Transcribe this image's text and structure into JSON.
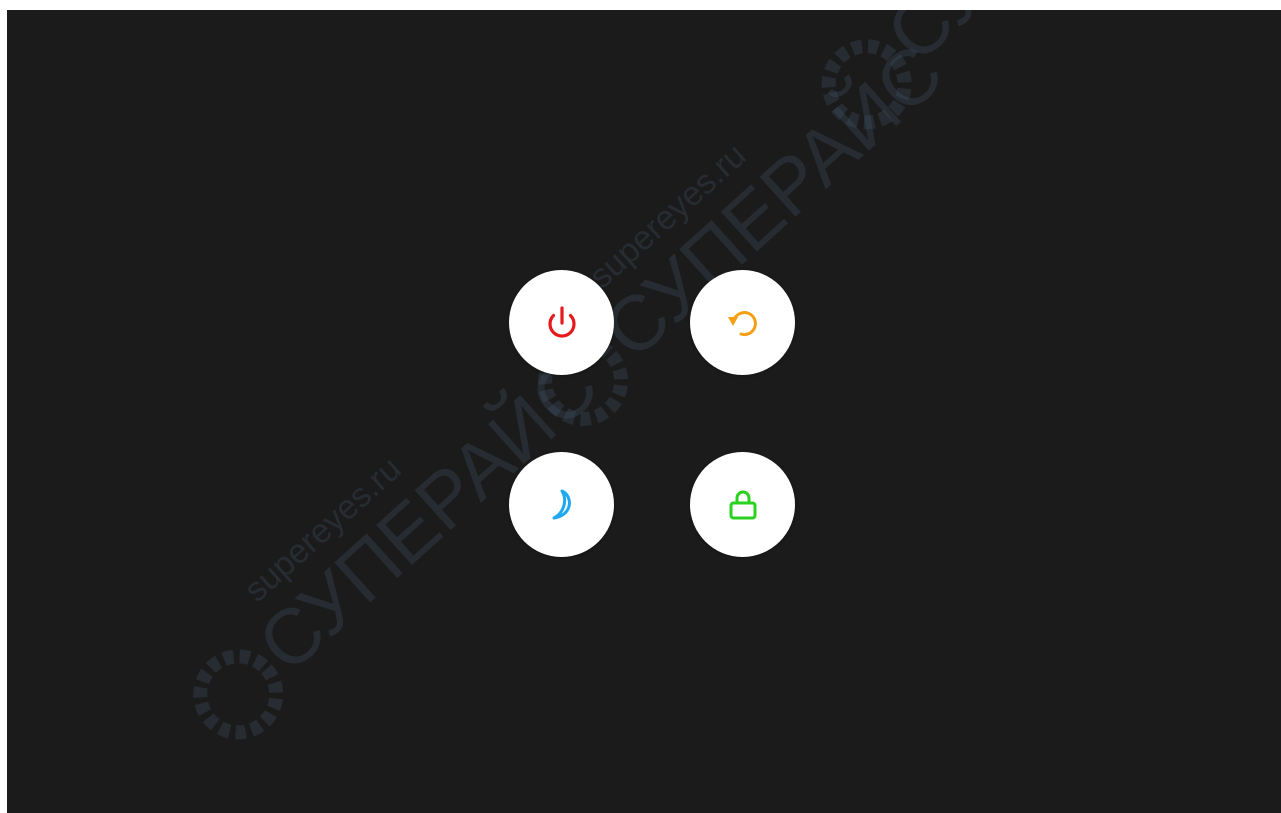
{
  "power_menu": {
    "actions": [
      {
        "id": "power",
        "icon": "power-icon",
        "color": "#e8191c"
      },
      {
        "id": "restart",
        "icon": "restart-icon",
        "color": "#f5a012"
      },
      {
        "id": "sleep",
        "icon": "moon-icon",
        "color": "#1ea8f0"
      },
      {
        "id": "lock",
        "icon": "lock-icon",
        "color": "#2ad11f"
      }
    ]
  },
  "watermark": {
    "site": "supereyes.ru",
    "brand": "СУПЕРАЙС"
  },
  "colors": {
    "background": "#1b1b1b",
    "button": "#ffffff"
  }
}
